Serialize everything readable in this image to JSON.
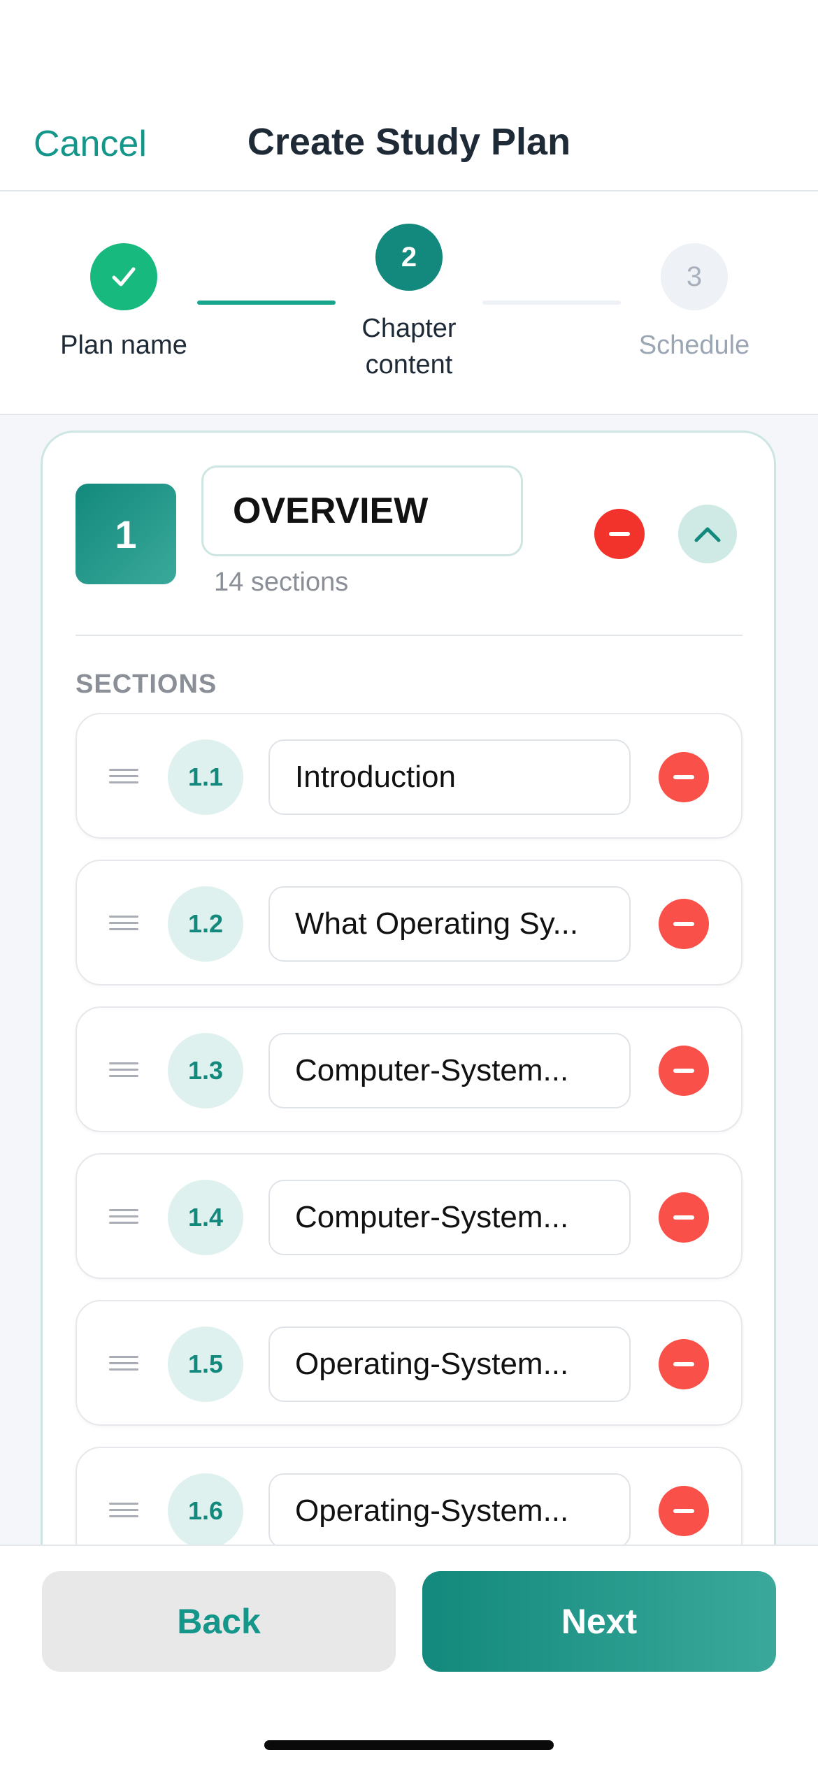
{
  "header": {
    "cancel_label": "Cancel",
    "title": "Create Study Plan"
  },
  "stepper": {
    "steps": [
      {
        "number": "1",
        "label": "Plan name",
        "state": "completed"
      },
      {
        "number": "2",
        "label": "Chapter content",
        "label_line1": "Chapter",
        "label_line2": "content",
        "state": "active"
      },
      {
        "number": "3",
        "label": "Schedule",
        "state": "upcoming"
      }
    ]
  },
  "chapter": {
    "number": "1",
    "name": "OVERVIEW",
    "section_count": "14 sections",
    "sections_heading": "SECTIONS",
    "sections": [
      {
        "number": "1.1",
        "title": "Introduction"
      },
      {
        "number": "1.2",
        "title": "What Operating Sy..."
      },
      {
        "number": "1.3",
        "title": "Computer-System..."
      },
      {
        "number": "1.4",
        "title": "Computer-System..."
      },
      {
        "number": "1.5",
        "title": "Operating-System..."
      },
      {
        "number": "1.6",
        "title": "Operating-System..."
      }
    ]
  },
  "footer": {
    "back_label": "Back",
    "next_label": "Next"
  },
  "colors": {
    "accent": "#12897c",
    "success": "#17b97f",
    "danger": "#f1332c"
  }
}
